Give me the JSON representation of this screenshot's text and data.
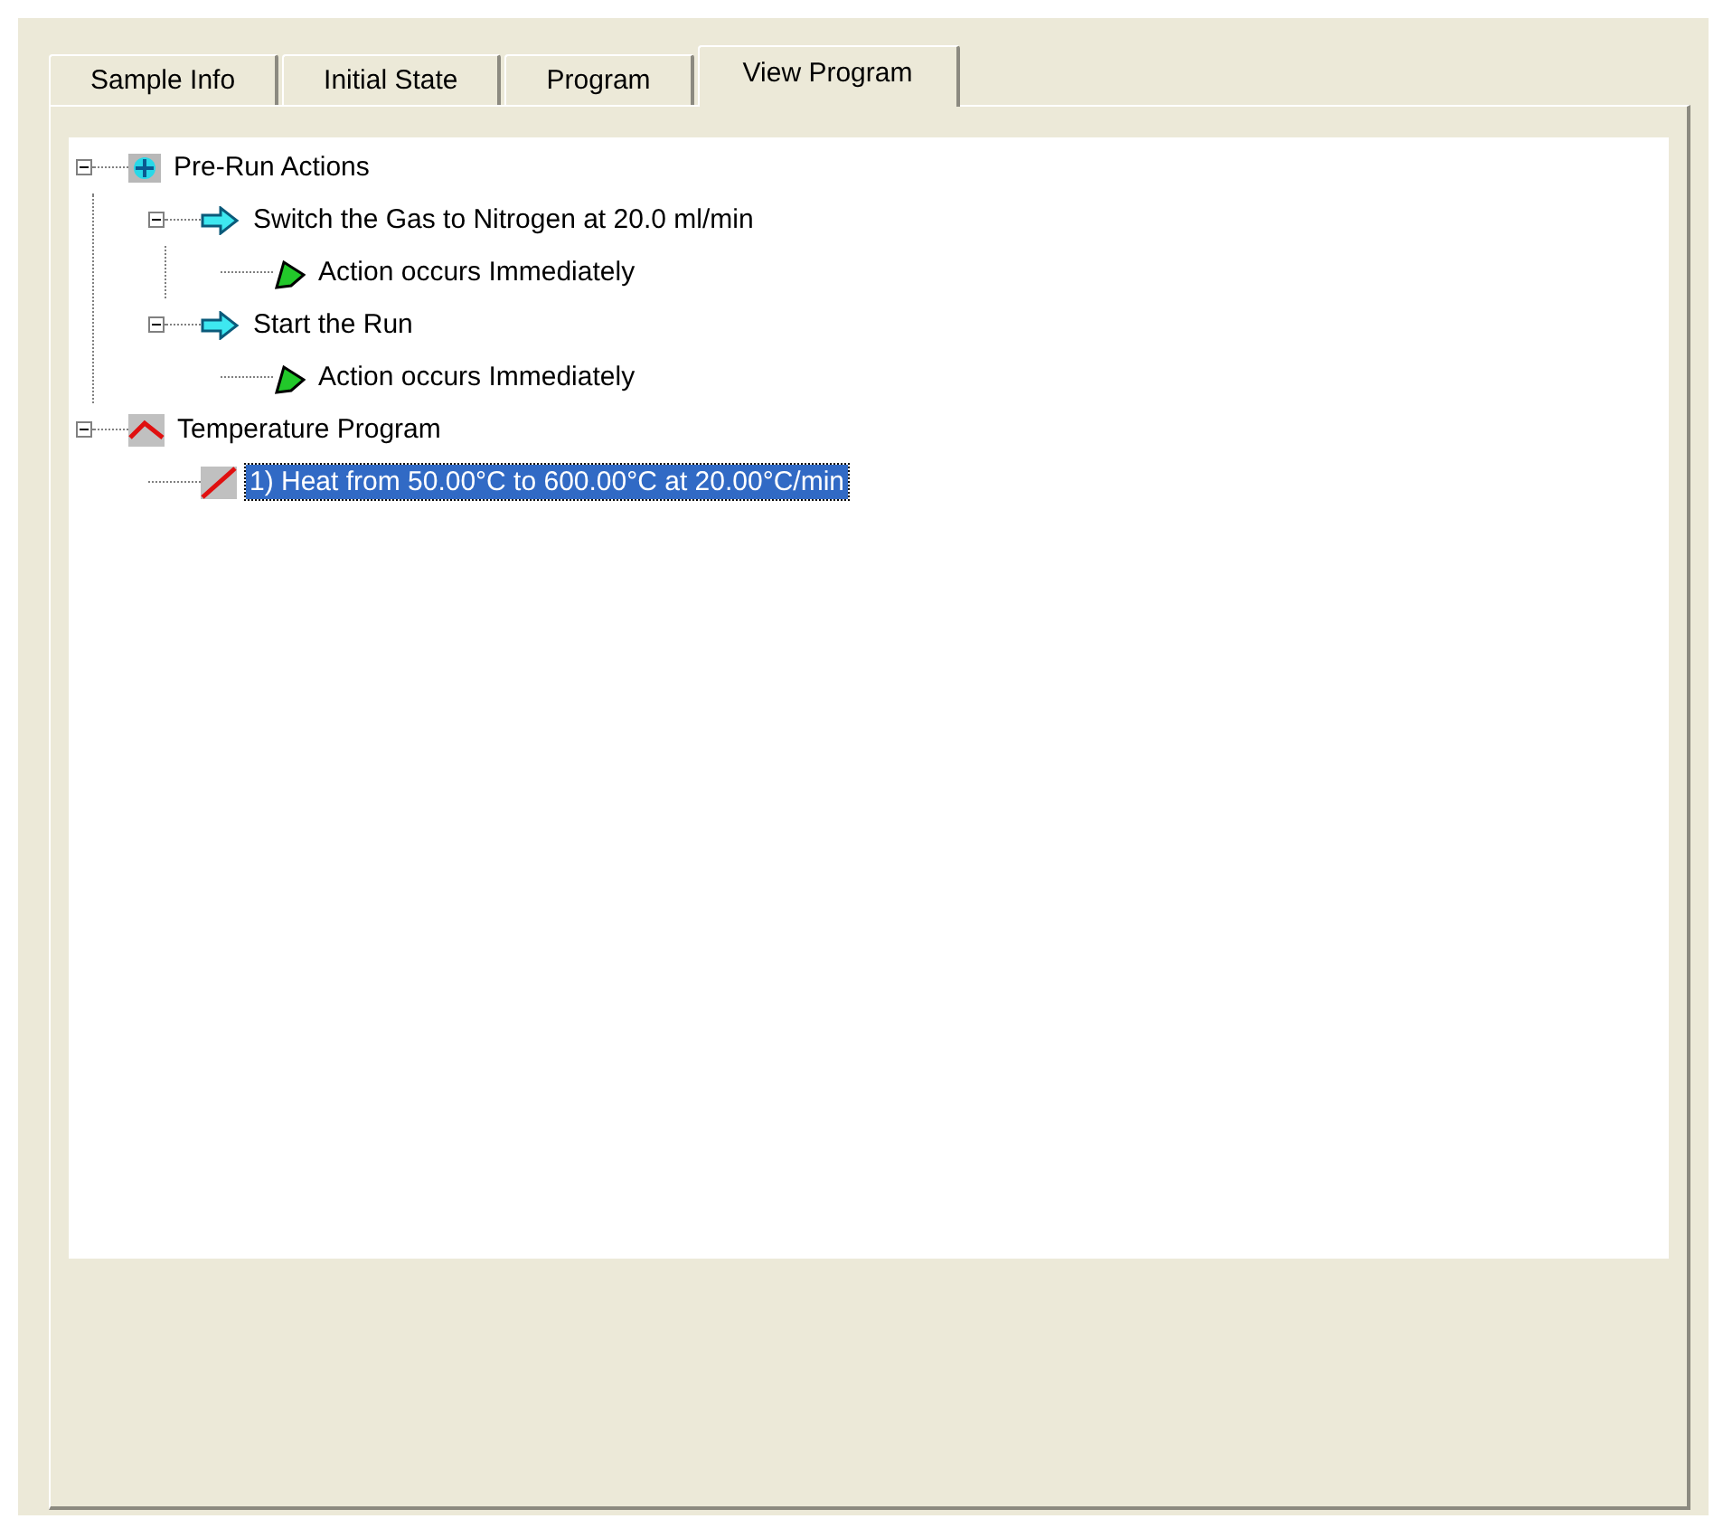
{
  "tabs": [
    {
      "label": "Sample Info",
      "selected": false
    },
    {
      "label": "Initial State",
      "selected": false
    },
    {
      "label": "Program",
      "selected": false
    },
    {
      "label": "View Program",
      "selected": true
    }
  ],
  "tree": [
    {
      "kind": "actions-group",
      "label": "Pre-Run Actions",
      "expanded": true,
      "selected": false,
      "children": [
        {
          "kind": "action",
          "label": "Switch the Gas to Nitrogen at 20.0 ml/min",
          "expanded": true,
          "selected": false,
          "children": [
            {
              "kind": "condition",
              "label": "Action occurs Immediately",
              "selected": false
            }
          ]
        },
        {
          "kind": "action",
          "label": "Start the Run",
          "expanded": true,
          "selected": false,
          "children": [
            {
              "kind": "condition",
              "label": "Action occurs Immediately",
              "selected": false
            }
          ]
        }
      ]
    },
    {
      "kind": "program-group",
      "label": "Temperature Program",
      "expanded": true,
      "selected": false,
      "children": [
        {
          "kind": "segment",
          "label": "1) Heat from 50.00°C to 600.00°C at 20.00°C/min",
          "selected": true
        }
      ]
    }
  ]
}
